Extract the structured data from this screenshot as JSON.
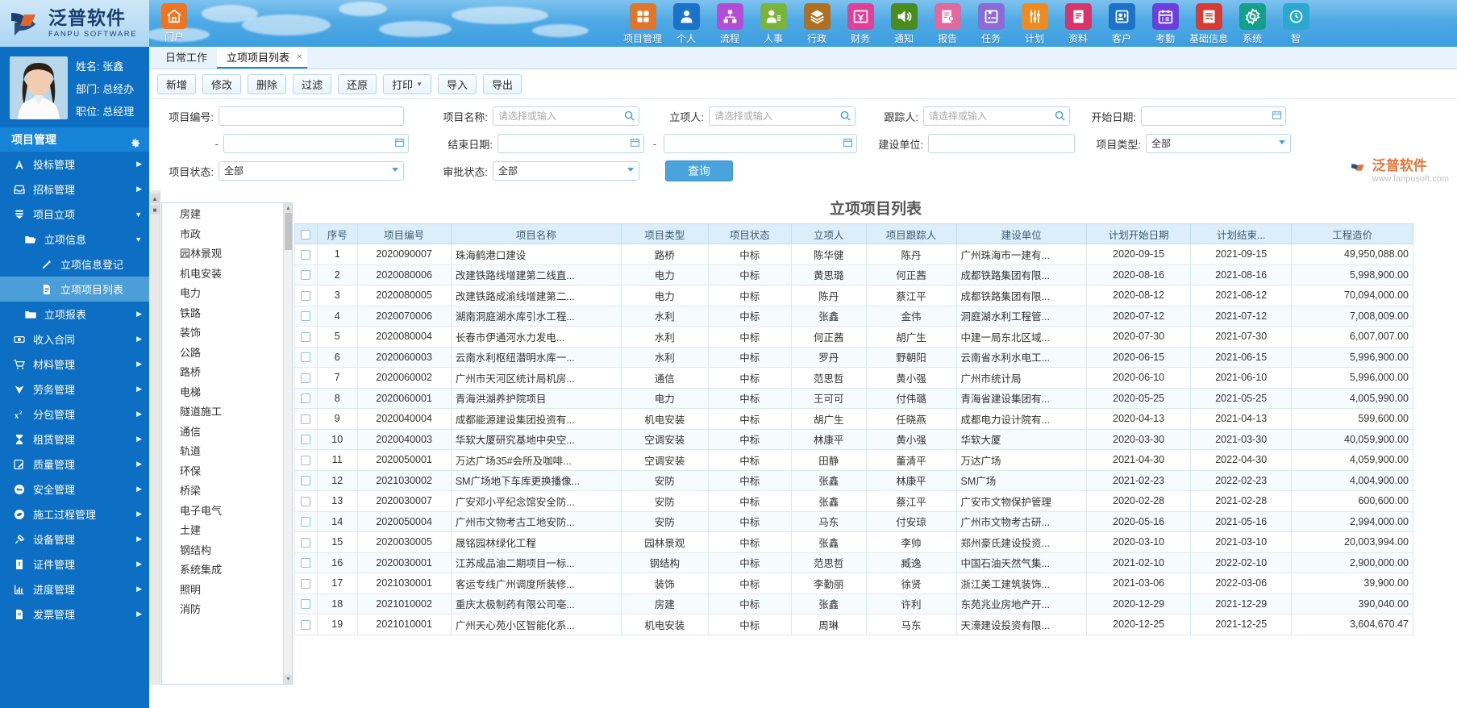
{
  "brand": {
    "name_cn": "泛普软件",
    "name_en": "FANPU SOFTWARE",
    "portal_label": "门户",
    "portal_icon": "home-icon"
  },
  "topnav": [
    {
      "label": "项目管理",
      "icon": "grid-icon",
      "color": "#e0762a"
    },
    {
      "label": "个人",
      "icon": "person-icon",
      "color": "#1a73c8"
    },
    {
      "label": "流程",
      "icon": "sitemap-icon",
      "color": "#b44cd6"
    },
    {
      "label": "人事",
      "icon": "user-list-icon",
      "color": "#7ab53a"
    },
    {
      "label": "行政",
      "icon": "layers-icon",
      "color": "#b07020"
    },
    {
      "label": "财务",
      "icon": "money-icon",
      "color": "#e04095"
    },
    {
      "label": "通知",
      "icon": "speaker-icon",
      "color": "#4a8c1e"
    },
    {
      "label": "报告",
      "icon": "report-icon",
      "color": "#e06aa0"
    },
    {
      "label": "任务",
      "icon": "task-icon",
      "color": "#8e6ad6"
    },
    {
      "label": "计划",
      "icon": "sliders-icon",
      "color": "#ef8b1e"
    },
    {
      "label": "资料",
      "icon": "document-icon",
      "color": "#d8336b"
    },
    {
      "label": "客户",
      "icon": "customer-icon",
      "color": "#1a73c8"
    },
    {
      "label": "考勤",
      "icon": "calendar-check-icon",
      "color": "#6f3ce0"
    },
    {
      "label": "基础信息",
      "icon": "base-info-icon",
      "color": "#d93b33"
    },
    {
      "label": "系统",
      "icon": "gear-icon",
      "color": "#12a08a"
    },
    {
      "label": "智",
      "icon": "smart-icon",
      "color": "#2aa8d0"
    }
  ],
  "sidebar": {
    "user": {
      "name_label": "姓名: 张鑫",
      "dept_label": "部门: 总经办",
      "title_label": "职位: 总经理"
    },
    "section_title": "项目管理",
    "items": [
      {
        "label": "投标管理",
        "icon": "bid-icon",
        "level": 1,
        "arrow": "right",
        "active": false
      },
      {
        "label": "招标管理",
        "icon": "inbox-icon",
        "level": 1,
        "arrow": "right",
        "active": false
      },
      {
        "label": "项目立项",
        "icon": "list-icon",
        "level": 1,
        "arrow": "down",
        "active": false
      },
      {
        "label": "立项信息",
        "icon": "folder-open-icon",
        "level": 2,
        "arrow": "down",
        "active": false
      },
      {
        "label": "立项信息登记",
        "icon": "pencil-icon",
        "level": 3,
        "arrow": "",
        "active": false
      },
      {
        "label": "立项项目列表",
        "icon": "file-icon",
        "level": 3,
        "arrow": "",
        "active": true
      },
      {
        "label": "立项报表",
        "icon": "folder-icon",
        "level": 2,
        "arrow": "right",
        "active": false
      },
      {
        "label": "收入合同",
        "icon": "contract-icon",
        "level": 1,
        "arrow": "right",
        "active": false
      },
      {
        "label": "材料管理",
        "icon": "cart-icon",
        "level": 1,
        "arrow": "right",
        "active": false
      },
      {
        "label": "劳务管理",
        "icon": "labor-icon",
        "level": 1,
        "arrow": "right",
        "active": false
      },
      {
        "label": "分包管理",
        "icon": "x2-icon",
        "level": 1,
        "arrow": "right",
        "active": false
      },
      {
        "label": "租赁管理",
        "icon": "hourglass-icon",
        "level": 1,
        "arrow": "right",
        "active": false
      },
      {
        "label": "质量管理",
        "icon": "edit-box-icon",
        "level": 1,
        "arrow": "right",
        "active": false
      },
      {
        "label": "安全管理",
        "icon": "safety-icon",
        "level": 1,
        "arrow": "right",
        "active": false
      },
      {
        "label": "施工过程管理",
        "icon": "process-icon",
        "level": 1,
        "arrow": "right",
        "active": false
      },
      {
        "label": "设备管理",
        "icon": "plug-icon",
        "level": 1,
        "arrow": "right",
        "active": false
      },
      {
        "label": "证件管理",
        "icon": "certificate-icon",
        "level": 1,
        "arrow": "right",
        "active": false
      },
      {
        "label": "进度管理",
        "icon": "chart-bar-icon",
        "level": 1,
        "arrow": "right",
        "active": false
      },
      {
        "label": "发票管理",
        "icon": "invoice-icon",
        "level": 1,
        "arrow": "right",
        "active": false
      }
    ]
  },
  "tabs": [
    {
      "label": "日常工作",
      "active": false,
      "closable": false
    },
    {
      "label": "立项项目列表",
      "active": true,
      "closable": true
    }
  ],
  "toolbar": [
    {
      "label": "新增",
      "name": "add-button"
    },
    {
      "label": "修改",
      "name": "edit-button"
    },
    {
      "label": "删除",
      "name": "delete-button"
    },
    {
      "label": "过滤",
      "name": "filter-button"
    },
    {
      "label": "还原",
      "name": "restore-button"
    },
    {
      "label": "打印",
      "name": "print-button",
      "caret": true
    },
    {
      "label": "导入",
      "name": "import-button"
    },
    {
      "label": "导出",
      "name": "export-button"
    }
  ],
  "search": {
    "project_no_label": "项目编号:",
    "project_no_value": "",
    "project_name_label": "项目名称:",
    "project_name_placeholder": "请选择或输入",
    "proposer_label": "立项人:",
    "proposer_placeholder": "请选择或输入",
    "tracker_label": "跟踪人:",
    "tracker_placeholder": "请选择或输入",
    "start_date_label": "开始日期:",
    "start_date_value": "",
    "start_date_to_value": "",
    "end_date_label": "结束日期:",
    "end_date_value": "",
    "end_date_to_value": "",
    "build_unit_label": "建设单位:",
    "build_unit_value": "",
    "project_type_label": "项目类型:",
    "project_type_value": "全部",
    "project_status_label": "项目状态:",
    "project_status_value": "全部",
    "approval_status_label": "审批状态:",
    "approval_status_value": "全部",
    "query_button": "查询",
    "dash": "-"
  },
  "tree": {
    "items": [
      "房建",
      "市政",
      "园林景观",
      "机电安装",
      "电力",
      "铁路",
      "装饰",
      "公路",
      "路桥",
      "电梯",
      "隧道施工",
      "通信",
      "轨道",
      "环保",
      "桥梁",
      "电子电气",
      "土建",
      "钢结构",
      "系统集成",
      "照明",
      "消防"
    ]
  },
  "grid": {
    "title": "立项项目列表",
    "columns": [
      "序号",
      "项目编号",
      "项目名称",
      "项目类型",
      "项目状态",
      "立项人",
      "项目跟踪人",
      "建设单位",
      "计划开始日期",
      "计划结束...",
      "工程造价"
    ],
    "rows": [
      {
        "no": "1",
        "code": "2020090007",
        "name": "珠海鹤港口建设",
        "type": "路桥",
        "status": "中标",
        "proposer": "陈华健",
        "tracker": "陈丹",
        "unit": "广州珠海市一建有...",
        "start": "2020-09-15",
        "end": "2021-09-15",
        "cost": "49,950,088.00"
      },
      {
        "no": "2",
        "code": "2020080006",
        "name": "改建铁路线增建第二线直...",
        "type": "电力",
        "status": "中标",
        "proposer": "黄思璐",
        "tracker": "何正茜",
        "unit": "成都铁路集团有限...",
        "start": "2020-08-16",
        "end": "2021-08-16",
        "cost": "5,998,900.00"
      },
      {
        "no": "3",
        "code": "2020080005",
        "name": "改建铁路成渝线增建第二...",
        "type": "电力",
        "status": "中标",
        "proposer": "陈丹",
        "tracker": "蔡江平",
        "unit": "成都铁路集团有限...",
        "start": "2020-08-12",
        "end": "2021-08-12",
        "cost": "70,094,000.00"
      },
      {
        "no": "4",
        "code": "2020070006",
        "name": "湖南洞庭湖水库引水工程...",
        "type": "水利",
        "status": "中标",
        "proposer": "张鑫",
        "tracker": "金伟",
        "unit": "洞庭湖水利工程管...",
        "start": "2020-07-12",
        "end": "2021-07-12",
        "cost": "7,008,009.00"
      },
      {
        "no": "5",
        "code": "2020080004",
        "name": "长春市伊通河水力发电...",
        "type": "水利",
        "status": "中标",
        "proposer": "何正茜",
        "tracker": "胡广生",
        "unit": "中建一局东北区域...",
        "start": "2020-07-30",
        "end": "2021-07-30",
        "cost": "6,007,007.00"
      },
      {
        "no": "6",
        "code": "2020060003",
        "name": "云南水利枢纽潜明水库一...",
        "type": "水利",
        "status": "中标",
        "proposer": "罗丹",
        "tracker": "野朝阳",
        "unit": "云南省水利水电工...",
        "start": "2020-06-15",
        "end": "2021-06-15",
        "cost": "5,996,900.00"
      },
      {
        "no": "7",
        "code": "2020060002",
        "name": "广州市天河区统计局机房...",
        "type": "通信",
        "status": "中标",
        "proposer": "范思哲",
        "tracker": "黄小强",
        "unit": "广州市统计局",
        "start": "2020-06-10",
        "end": "2021-06-10",
        "cost": "5,996,000.00"
      },
      {
        "no": "8",
        "code": "2020060001",
        "name": "青海洪湖养护院项目",
        "type": "电力",
        "status": "中标",
        "proposer": "王可可",
        "tracker": "付伟璐",
        "unit": "青海省建设集团有...",
        "start": "2020-05-25",
        "end": "2021-05-25",
        "cost": "4,005,990.00"
      },
      {
        "no": "9",
        "code": "2020040004",
        "name": "成都能源建设集团投资有...",
        "type": "机电安装",
        "status": "中标",
        "proposer": "胡广生",
        "tracker": "任晓燕",
        "unit": "成都电力设计院有...",
        "start": "2020-04-13",
        "end": "2021-04-13",
        "cost": "599,600.00"
      },
      {
        "no": "10",
        "code": "2020040003",
        "name": "华软大厦研究基地中央空...",
        "type": "空调安装",
        "status": "中标",
        "proposer": "林康平",
        "tracker": "黄小强",
        "unit": "华软大厦",
        "start": "2020-03-30",
        "end": "2021-03-30",
        "cost": "40,059,900.00"
      },
      {
        "no": "11",
        "code": "2020050001",
        "name": "万达广场35#会所及咖啡...",
        "type": "空调安装",
        "status": "中标",
        "proposer": "田静",
        "tracker": "董清平",
        "unit": "万达广场",
        "start": "2021-04-30",
        "end": "2022-04-30",
        "cost": "4,059,900.00"
      },
      {
        "no": "12",
        "code": "2021030002",
        "name": "SM广场地下车库更换播像...",
        "type": "安防",
        "status": "中标",
        "proposer": "张鑫",
        "tracker": "林康平",
        "unit": "SM广场",
        "start": "2021-02-23",
        "end": "2022-02-23",
        "cost": "4,004,900.00"
      },
      {
        "no": "13",
        "code": "2020030007",
        "name": "广安邓小平纪念馆安全防...",
        "type": "安防",
        "status": "中标",
        "proposer": "张鑫",
        "tracker": "蔡江平",
        "unit": "广安市文物保护管理",
        "start": "2020-02-28",
        "end": "2021-02-28",
        "cost": "600,600.00"
      },
      {
        "no": "14",
        "code": "2020050004",
        "name": "广州市文物考古工地安防...",
        "type": "安防",
        "status": "中标",
        "proposer": "马东",
        "tracker": "付安琼",
        "unit": "广州市文物考古研...",
        "start": "2020-05-16",
        "end": "2021-05-16",
        "cost": "2,994,000.00"
      },
      {
        "no": "15",
        "code": "2020030005",
        "name": "晟铭园林绿化工程",
        "type": "园林景观",
        "status": "中标",
        "proposer": "张鑫",
        "tracker": "李帅",
        "unit": "郑州豪氏建设投资...",
        "start": "2020-03-10",
        "end": "2021-03-10",
        "cost": "20,003,994.00"
      },
      {
        "no": "16",
        "code": "2020030001",
        "name": "江苏成品油二期项目一标...",
        "type": "钢结构",
        "status": "中标",
        "proposer": "范思哲",
        "tracker": "臧逸",
        "unit": "中国石油天然气集...",
        "start": "2021-02-10",
        "end": "2022-02-10",
        "cost": "2,900,000.00"
      },
      {
        "no": "17",
        "code": "2021030001",
        "name": "客运专线广州调度所装修...",
        "type": "装饰",
        "status": "中标",
        "proposer": "李勤丽",
        "tracker": "徐贤",
        "unit": "浙江美工建筑装饰...",
        "start": "2021-03-06",
        "end": "2022-03-06",
        "cost": "39,900.00"
      },
      {
        "no": "18",
        "code": "2021010002",
        "name": "重庆太极制药有限公司亳...",
        "type": "房建",
        "status": "中标",
        "proposer": "张鑫",
        "tracker": "许利",
        "unit": "东苑兆业房地产开...",
        "start": "2020-12-29",
        "end": "2021-12-29",
        "cost": "390,040.00"
      },
      {
        "no": "19",
        "code": "2021010001",
        "name": "广州天心苑小区智能化系...",
        "type": "机电安装",
        "status": "中标",
        "proposer": "周琳",
        "tracker": "马东",
        "unit": "天濠建设投资有限...",
        "start": "2020-12-25",
        "end": "2021-12-25",
        "cost": "3,604,670.47"
      }
    ]
  },
  "watermark": {
    "text": "泛普软件",
    "sub": "www.fanpusoft.com"
  }
}
